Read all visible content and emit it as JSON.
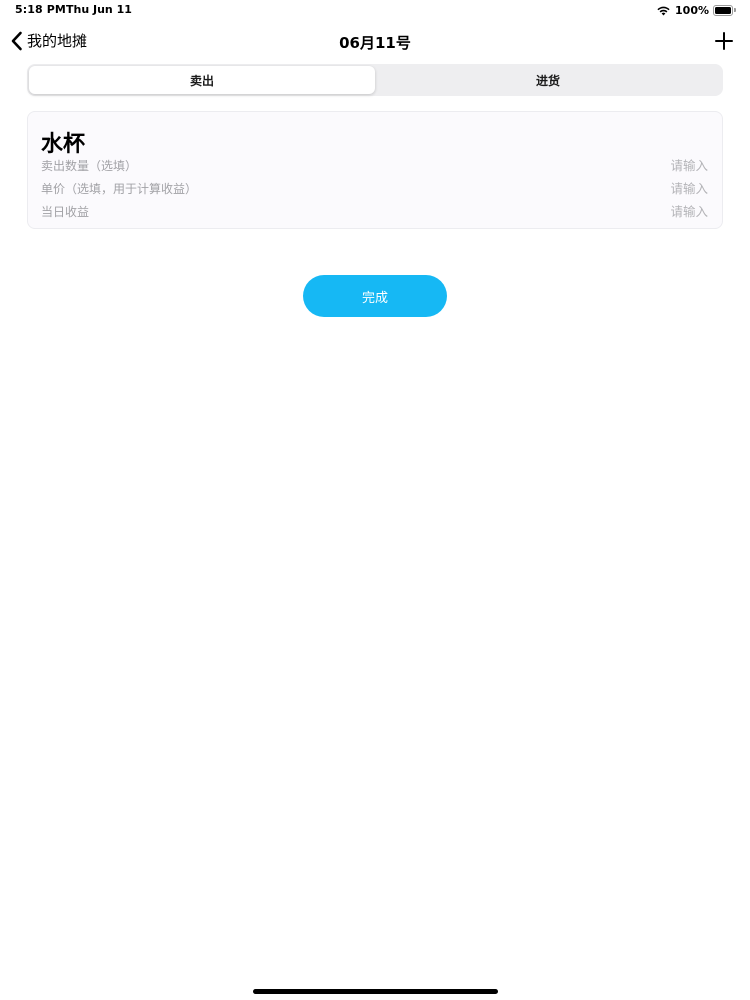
{
  "status_bar": {
    "time": "5:18 PM",
    "date": "Thu Jun 11",
    "battery": "100%"
  },
  "nav": {
    "back_label": "我的地摊",
    "title": "06月11号",
    "add_icon": "plus-icon",
    "back_icon": "chevron-left-icon"
  },
  "segments": {
    "items": [
      "卖出",
      "进货"
    ],
    "selected": "卖出"
  },
  "card": {
    "title": "水杯",
    "fields": [
      {
        "label": "卖出数量（选填）",
        "value": "",
        "placeholder": "请输入"
      },
      {
        "label": "单价（选填，用于计算收益）",
        "value": "",
        "placeholder": "请输入"
      },
      {
        "label": "当日收益",
        "value": "",
        "placeholder": "请输入"
      }
    ]
  },
  "done_button": {
    "label": "完成"
  },
  "colors": {
    "accent": "#16b8f4",
    "placeholder": "#b3b3b7",
    "label": "#a2a2a6",
    "segment_bg": "#eeeef0"
  }
}
